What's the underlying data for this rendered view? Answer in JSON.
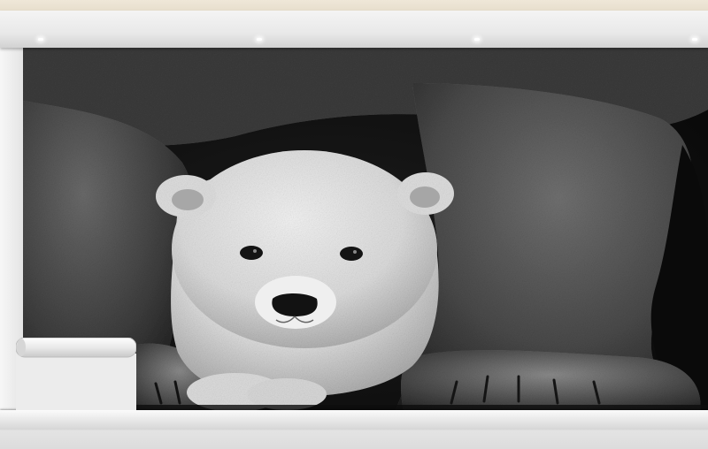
{
  "scene": {
    "description_type": "wall-mural-mockup",
    "palette": {
      "ceiling": "#ebe3d3",
      "trim": "#ececec",
      "wall": "#f0f0f0",
      "mural_dark": "#0c0c0c",
      "fur_adult": "#4a4a4a",
      "fur_cub": "#e2e2e2",
      "floor": "#e0e0e0"
    },
    "spotlight_count": 4,
    "icons": [
      "spotlight-icon",
      "polar-bear-cub-icon",
      "rolled-paper-corner-icon"
    ]
  }
}
